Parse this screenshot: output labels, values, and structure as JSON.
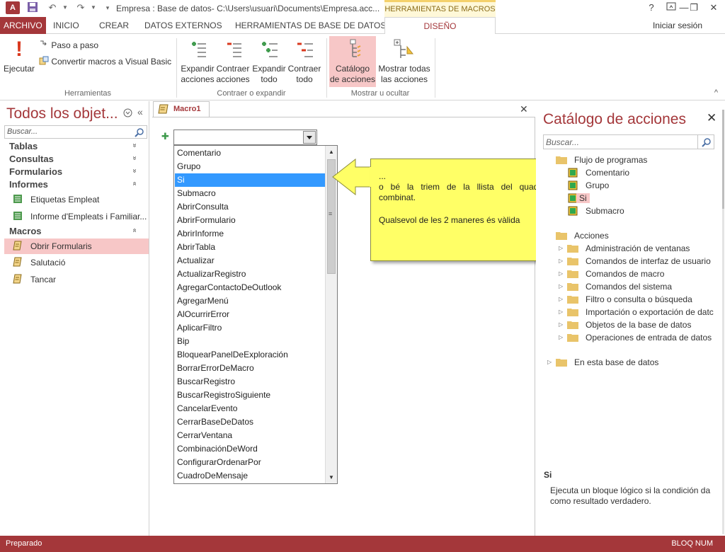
{
  "window": {
    "app_icon": "A",
    "title": "Empresa : Base de datos- C:\\Users\\usuari\\Documents\\Empresa.acc...",
    "context_tab": "HERRAMIENTAS DE MACROS",
    "help": "?",
    "restore": "⧉",
    "minimize": "—",
    "maximize": "❐",
    "close": "✕"
  },
  "quick_access": {
    "save_icon": "save-icon",
    "undo_icon": "undo-icon",
    "redo_icon": "redo-icon",
    "customize_icon": "customize-icon"
  },
  "tabs": [
    {
      "label": "ARCHIVO"
    },
    {
      "label": "INICIO"
    },
    {
      "label": "CREAR"
    },
    {
      "label": "DATOS EXTERNOS"
    },
    {
      "label": "HERRAMIENTAS DE BASE DE DATOS"
    },
    {
      "label": "DISEÑO"
    }
  ],
  "signin": "Iniciar sesión",
  "ribbon": {
    "run": {
      "label": "Ejecutar",
      "glyph": "!"
    },
    "step": "Paso a paso",
    "convert": "Convertir macros a Visual Basic",
    "group_tools": "Herramientas",
    "expand_actions": [
      "Expandir",
      "acciones"
    ],
    "collapse_actions": [
      "Contraer",
      "acciones"
    ],
    "expand_all": [
      "Expandir",
      "todo"
    ],
    "collapse_all": [
      "Contraer",
      "todo"
    ],
    "group_expand": "Contraer o expandir",
    "action_catalog": [
      "Catálogo",
      "de acciones"
    ],
    "show_all": [
      "Mostrar todas",
      "las acciones"
    ],
    "group_show": "Mostrar u ocultar",
    "collapse_ribbon": "^"
  },
  "nav": {
    "title": "Todos los objet...",
    "search_placeholder": "Buscar...",
    "groups": {
      "tables": "Tablas",
      "queries": "Consultas",
      "forms": "Formularios",
      "reports": "Informes",
      "macros": "Macros"
    },
    "reports": [
      "Etiquetas Empleat",
      "Informe d'Empleats i Familiar..."
    ],
    "macros": [
      "Obrir Formularis",
      "Salutació",
      "Tancar"
    ],
    "chevron_down": "»",
    "chevron_up": "»"
  },
  "document": {
    "tab_label": "Macro1",
    "close": "✕",
    "plus": "✚",
    "dropdown_items": [
      "Comentario",
      "Grupo",
      "Si",
      "Submacro",
      "AbrirConsulta",
      "AbrirFormulario",
      "AbrirInforme",
      "AbrirTabla",
      "Actualizar",
      "ActualizarRegistro",
      "AgregarContactoDeOutlook",
      "AgregarMenú",
      "AlOcurrirError",
      "AplicarFiltro",
      "Bip",
      "BloquearPanelDeExploración",
      "BorrarErrorDeMacro",
      "BuscarRegistro",
      "BuscarRegistroSiguiente",
      "CancelarEvento",
      "CerrarBaseDeDatos",
      "CerrarVentana",
      "CombinaciónDeWord",
      "ConfigurarOrdenarPor",
      "CuadroDeMensaje"
    ],
    "selected_index": 2
  },
  "callout": {
    "line1": "...",
    "line2": "o bé la triem de la llista del quadre",
    "line3": "combinat.",
    "line4": "Qualsevol de les 2 maneres és vàlida"
  },
  "catalog": {
    "title": "Catálogo de acciones",
    "close": "✕",
    "search_placeholder": "Buscar...",
    "program_flow": "Flujo de programas",
    "flow_items": [
      "Comentario",
      "Grupo",
      "Si",
      "Submacro"
    ],
    "actions": "Acciones",
    "action_folders": [
      "Administración de ventanas",
      "Comandos de interfaz de usuario",
      "Comandos de macro",
      "Comandos del sistema",
      "Filtro o consulta o búsqueda",
      "Importación o exportación de datc",
      "Objetos de la base de datos",
      "Operaciones de entrada de datos"
    ],
    "in_database": "En esta base de datos",
    "desc_title": "Si",
    "desc_text": "Ejecuta un bloque lógico si la condición da como resultado verdadero."
  },
  "status": {
    "left": "Preparado",
    "right": "BLOQ NUM"
  },
  "colors": {
    "accent": "#a4373a",
    "selection": "#3399ff",
    "highlight": "#f7c7c7",
    "callout": "#ffff66"
  }
}
